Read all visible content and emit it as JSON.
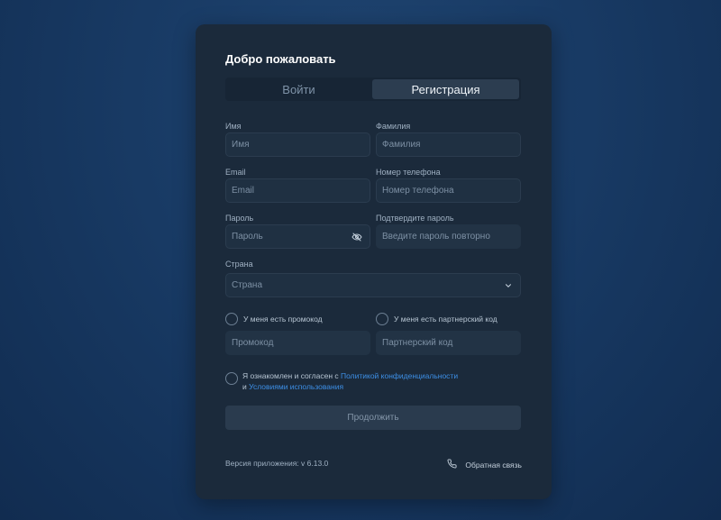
{
  "header": {
    "title": "Добро пожаловать"
  },
  "tabs": [
    {
      "label": "Войти",
      "active": false
    },
    {
      "label": "Регистрация",
      "active": true
    }
  ],
  "form": {
    "first_name": {
      "label": "Имя",
      "placeholder": "Имя"
    },
    "last_name": {
      "label": "Фамилия",
      "placeholder": "Фамилия"
    },
    "email": {
      "label": "Email",
      "placeholder": "Email"
    },
    "phone": {
      "label": "Номер телефона",
      "placeholder": "Номер телефона"
    },
    "password": {
      "label": "Пароль",
      "placeholder": "Пароль"
    },
    "confirm_password": {
      "label": "Подтвердите пароль",
      "placeholder": "Введите пароль повторно"
    },
    "country": {
      "label": "Страна",
      "placeholder": "Страна"
    },
    "promo_checkbox": {
      "label": "У меня есть промокод",
      "checked": false
    },
    "promo": {
      "placeholder": "Промокод"
    },
    "partner_checkbox": {
      "label": "У меня есть партнерский код",
      "checked": false
    },
    "partner": {
      "placeholder": "Партнерский код"
    },
    "agreement": {
      "prefix": "Я ознакомлен и согласен с ",
      "privacy_link": "Политикой конфиденциальности",
      "joiner": "и ",
      "terms_link": "Условиями использования",
      "checked": false
    },
    "submit_label": "Продолжить"
  },
  "footer": {
    "version": "Версия приложения: v 6.13.0",
    "feedback": "Обратная связь"
  },
  "icons": {
    "password_toggle": "eye-off-icon",
    "country_dropdown": "chevron-down-icon",
    "feedback": "phone-icon"
  },
  "colors": {
    "card": "#1b2a3b",
    "link": "#3d8fe6",
    "active_tab": "#2c3d50"
  }
}
